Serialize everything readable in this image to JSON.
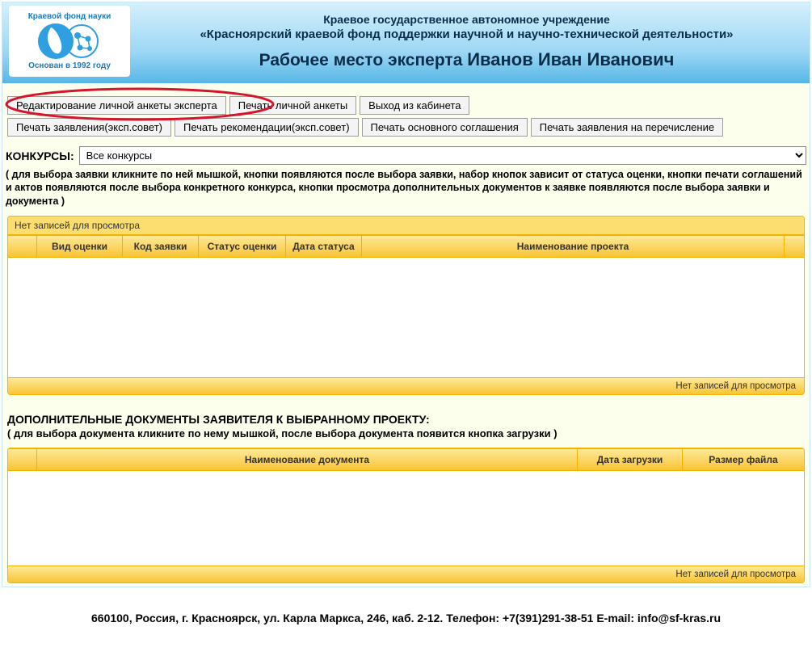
{
  "logo": {
    "top": "Краевой фонд науки",
    "bottom": "Основан в 1992 году"
  },
  "header": {
    "line1": "Краевое государственное автономное учреждение",
    "line2": "«Красноярский краевой фонд поддержки научной и научно-технической деятельности»",
    "line3_prefix": "Рабочее место эксперта ",
    "line3_name": "Иванов Иван Иванович"
  },
  "buttons": {
    "row1": {
      "edit_profile": "Редактирование личной анкеты эксперта",
      "print_profile": "Печать личной анкеты",
      "logout": "Выход из кабинета"
    },
    "row2": {
      "print_application": "Печать заявления(эксп.совет)",
      "print_recommendation": "Печать рекомендации(эксп.совет)",
      "print_agreement": "Печать основного соглашения",
      "print_transfer": "Печать заявления на перечисление"
    }
  },
  "filter": {
    "label": "КОНКУРСЫ:",
    "selected": "Все конкурсы"
  },
  "hint1": "( для выбора заявки кликните по ней мышкой, кнопки появляются после выбора заявки, набор кнопок зависит от статуса оценки, кнопки печати соглашений и актов появляются после выбора конкретного конкурса, кнопки просмотра дополнительных документов к заявке появляются после выбора заявки и документа )",
  "grid1": {
    "caption": "Нет записей для просмотра",
    "cols": {
      "c1": "Вид оценки",
      "c2": "Код заявки",
      "c3": "Статус оценки",
      "c4": "Дата статуса",
      "c5": "Наименование проекта"
    },
    "footer": "Нет записей для просмотра"
  },
  "section2": {
    "title": "ДОПОЛНИТЕЛЬНЫЕ ДОКУМЕНТЫ ЗАЯВИТЕЛЯ К ВЫБРАННОМУ ПРОЕКТУ:",
    "hint": "( для выбора документа кликните по нему мышкой, после выбора документа появится кнопка загрузки )"
  },
  "grid2": {
    "cols": {
      "c1": "Наименование документа",
      "c2": "Дата загрузки",
      "c3": "Размер файла"
    },
    "footer": "Нет записей для просмотра"
  },
  "footer": "660100, Россия, г. Красноярск, ул. Карла Маркса, 246, каб. 2-12. Телефон: +7(391)291-38-51 E-mail: info@sf-kras.ru"
}
